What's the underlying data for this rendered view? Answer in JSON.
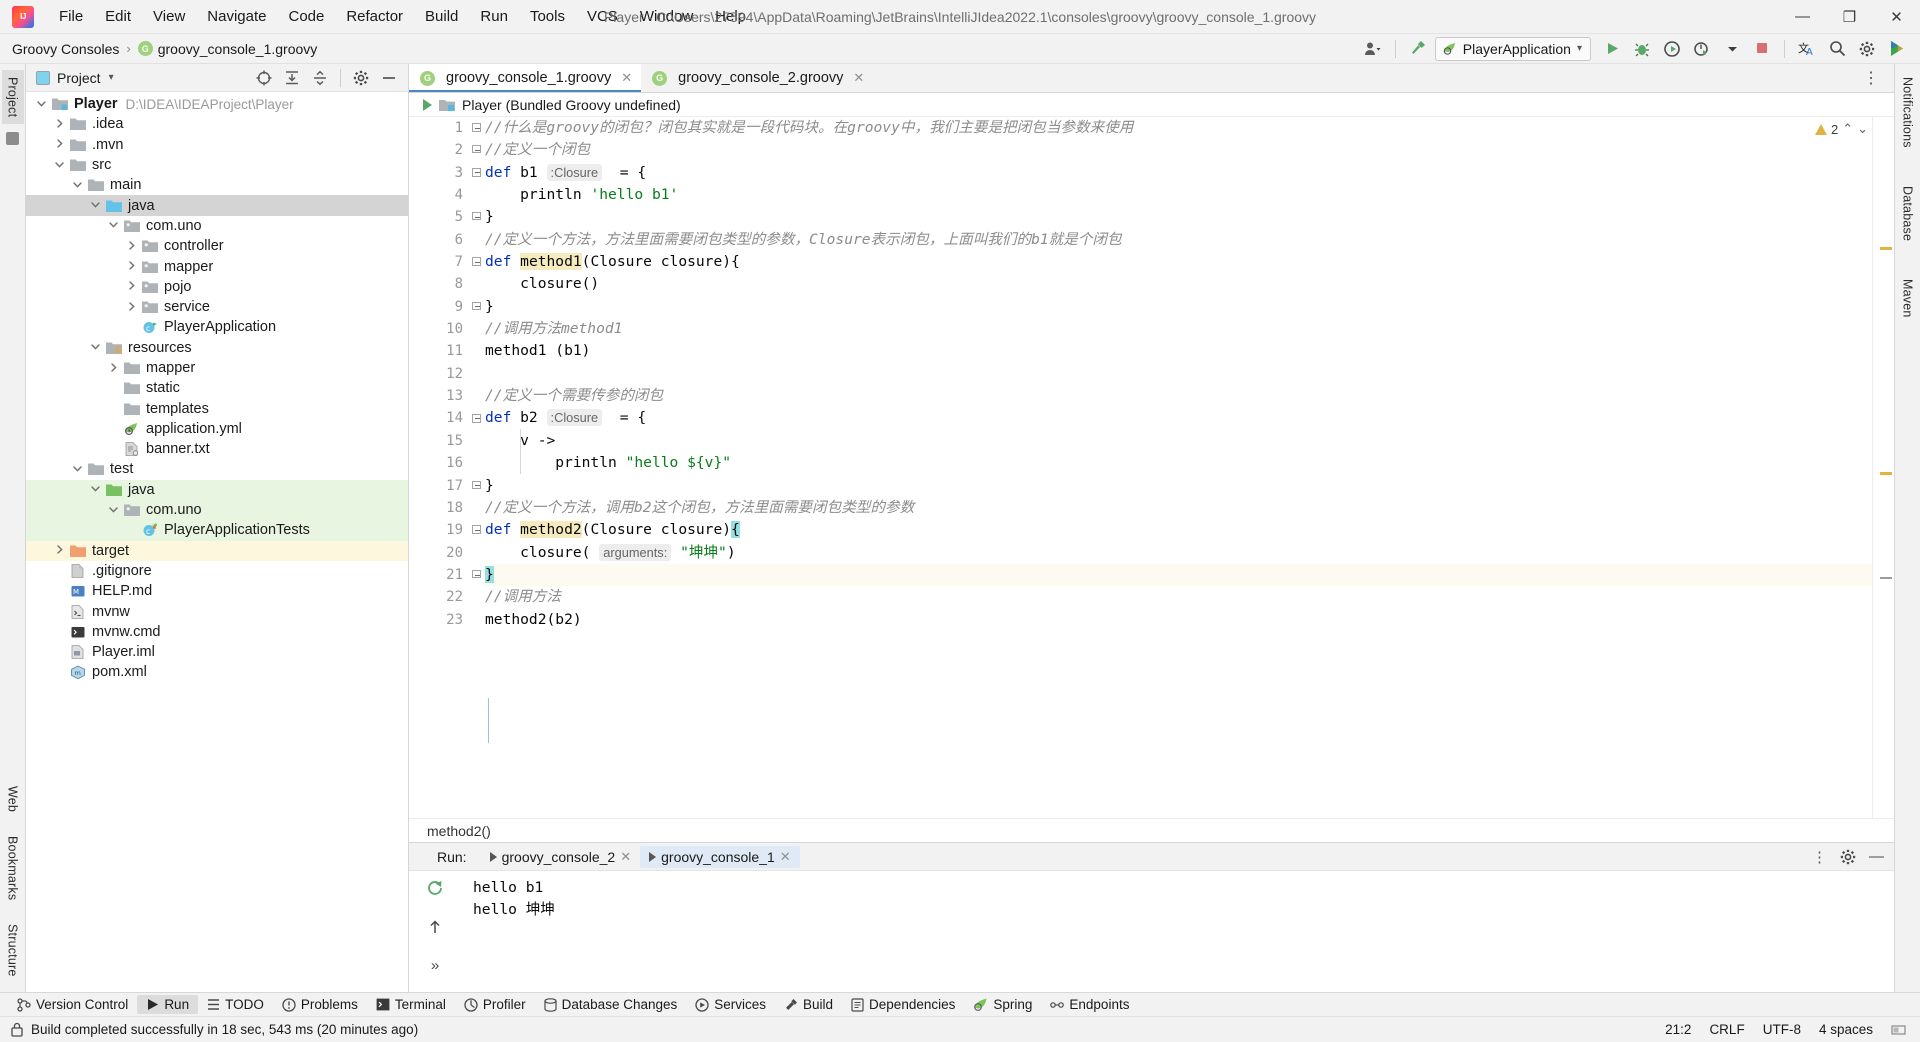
{
  "window": {
    "title": "Player - C:\\Users\\27594\\AppData\\Roaming\\JetBrains\\IntelliJIdea2022.1\\consoles\\groovy\\groovy_console_1.groovy",
    "minimize": "—",
    "maximize": "❐",
    "close": "✕"
  },
  "menubar": [
    {
      "label": "File"
    },
    {
      "label": "Edit"
    },
    {
      "label": "View"
    },
    {
      "label": "Navigate"
    },
    {
      "label": "Code"
    },
    {
      "label": "Refactor"
    },
    {
      "label": "Build"
    },
    {
      "label": "Run"
    },
    {
      "label": "Tools"
    },
    {
      "label": "VCS"
    },
    {
      "label": "Window"
    },
    {
      "label": "Help"
    }
  ],
  "navbar": {
    "crumbs": [
      "Groovy Consoles",
      "groovy_console_1.groovy"
    ],
    "separator": "›",
    "groovy_badge": "G",
    "run_config": "PlayerApplication",
    "run_config_chevron": "▾"
  },
  "left_strip": {
    "tabs": [
      "Project",
      "Structure",
      "Bookmarks",
      "Web"
    ]
  },
  "right_strip": {
    "tabs": [
      "Notifications",
      "Database",
      "Maven"
    ]
  },
  "project_panel": {
    "title": "Project",
    "chevron": "▾",
    "tree": [
      {
        "label": "Player",
        "path": "D:\\IDEA\\IDEAProject\\Player",
        "indent": 0,
        "chev": "down",
        "icon": "module-folder",
        "bold": true,
        "state": ""
      },
      {
        "label": ".idea",
        "path": "",
        "indent": 1,
        "chev": "right",
        "icon": "folder",
        "bold": false,
        "state": ""
      },
      {
        "label": ".mvn",
        "path": "",
        "indent": 1,
        "chev": "right",
        "icon": "folder",
        "bold": false,
        "state": ""
      },
      {
        "label": "src",
        "path": "",
        "indent": 1,
        "chev": "down",
        "icon": "folder",
        "bold": false,
        "state": ""
      },
      {
        "label": "main",
        "path": "",
        "indent": 2,
        "chev": "down",
        "icon": "folder",
        "bold": false,
        "state": ""
      },
      {
        "label": "java",
        "path": "",
        "indent": 3,
        "chev": "down",
        "icon": "source-folder",
        "bold": false,
        "state": "sel-gray"
      },
      {
        "label": "com.uno",
        "path": "",
        "indent": 4,
        "chev": "down",
        "icon": "package",
        "bold": false,
        "state": ""
      },
      {
        "label": "controller",
        "path": "",
        "indent": 5,
        "chev": "right",
        "icon": "package",
        "bold": false,
        "state": ""
      },
      {
        "label": "mapper",
        "path": "",
        "indent": 5,
        "chev": "right",
        "icon": "package",
        "bold": false,
        "state": ""
      },
      {
        "label": "pojo",
        "path": "",
        "indent": 5,
        "chev": "right",
        "icon": "package",
        "bold": false,
        "state": ""
      },
      {
        "label": "service",
        "path": "",
        "indent": 5,
        "chev": "right",
        "icon": "package",
        "bold": false,
        "state": ""
      },
      {
        "label": "PlayerApplication",
        "path": "",
        "indent": 5,
        "chev": "none",
        "icon": "spring-class",
        "bold": false,
        "state": ""
      },
      {
        "label": "resources",
        "path": "",
        "indent": 3,
        "chev": "down",
        "icon": "resource-folder",
        "bold": false,
        "state": ""
      },
      {
        "label": "mapper",
        "path": "",
        "indent": 4,
        "chev": "right",
        "icon": "folder",
        "bold": false,
        "state": ""
      },
      {
        "label": "static",
        "path": "",
        "indent": 4,
        "chev": "none",
        "icon": "folder",
        "bold": false,
        "state": ""
      },
      {
        "label": "templates",
        "path": "",
        "indent": 4,
        "chev": "none",
        "icon": "folder",
        "bold": false,
        "state": ""
      },
      {
        "label": "application.yml",
        "path": "",
        "indent": 4,
        "chev": "none",
        "icon": "spring-yml",
        "bold": false,
        "state": ""
      },
      {
        "label": "banner.txt",
        "path": "",
        "indent": 4,
        "chev": "none",
        "icon": "text-file",
        "bold": false,
        "state": ""
      },
      {
        "label": "test",
        "path": "",
        "indent": 2,
        "chev": "down",
        "icon": "folder",
        "bold": false,
        "state": ""
      },
      {
        "label": "java",
        "path": "",
        "indent": 3,
        "chev": "down",
        "icon": "test-source-folder",
        "bold": false,
        "state": "src-test"
      },
      {
        "label": "com.uno",
        "path": "",
        "indent": 4,
        "chev": "down",
        "icon": "package",
        "bold": false,
        "state": "src-test"
      },
      {
        "label": "PlayerApplicationTests",
        "path": "",
        "indent": 5,
        "chev": "none",
        "icon": "test-class",
        "bold": false,
        "state": "src-test"
      },
      {
        "label": "target",
        "path": "",
        "indent": 1,
        "chev": "right",
        "icon": "excluded-folder",
        "bold": false,
        "state": "excluded"
      },
      {
        "label": ".gitignore",
        "path": "",
        "indent": 1,
        "chev": "none",
        "icon": "gitignore-file",
        "bold": false,
        "state": ""
      },
      {
        "label": "HELP.md",
        "path": "",
        "indent": 1,
        "chev": "none",
        "icon": "md-file",
        "bold": false,
        "state": ""
      },
      {
        "label": "mvnw",
        "path": "",
        "indent": 1,
        "chev": "none",
        "icon": "script-file",
        "bold": false,
        "state": ""
      },
      {
        "label": "mvnw.cmd",
        "path": "",
        "indent": 1,
        "chev": "none",
        "icon": "cmd-file",
        "bold": false,
        "state": ""
      },
      {
        "label": "Player.iml",
        "path": "",
        "indent": 1,
        "chev": "none",
        "icon": "iml-file",
        "bold": false,
        "state": ""
      },
      {
        "label": "pom.xml",
        "path": "",
        "indent": 1,
        "chev": "none",
        "icon": "maven-file",
        "bold": false,
        "state": ""
      }
    ]
  },
  "editor": {
    "tabs": [
      {
        "label": "groovy_console_1.groovy",
        "badge": "G",
        "active": true,
        "close": "✕"
      },
      {
        "label": "groovy_console_2.groovy",
        "badge": "G",
        "active": false,
        "close": "✕"
      }
    ],
    "run_header": "Player (Bundled Groovy undefined)",
    "inspection": {
      "warnings": "2",
      "warn_icon": "warning-triangle",
      "chevron_up": "⌃",
      "chevron_down": "⌄"
    },
    "breadcrumb": "method2()",
    "lines": [
      {
        "n": "1",
        "fold": "start",
        "text": "//什么是groovy的闭包？闭包其实就是一段代码块。在groovy中，我们主要是把闭包当参数来使用"
      },
      {
        "n": "2",
        "fold": "end",
        "text": "//定义一个闭包"
      },
      {
        "n": "3",
        "fold": "start",
        "text": "def b1 :Closure  = {"
      },
      {
        "n": "4",
        "fold": "",
        "text": "    println 'hello b1'"
      },
      {
        "n": "5",
        "fold": "end",
        "text": "}"
      },
      {
        "n": "6",
        "fold": "",
        "text": "//定义一个方法，方法里面需要闭包类型的参数，Closure表示闭包，上面叫我们的b1就是个闭包"
      },
      {
        "n": "7",
        "fold": "start",
        "text": "def method1(Closure closure){"
      },
      {
        "n": "8",
        "fold": "",
        "text": "    closure()"
      },
      {
        "n": "9",
        "fold": "end",
        "text": "}"
      },
      {
        "n": "10",
        "fold": "",
        "text": "//调用方法method1"
      },
      {
        "n": "11",
        "fold": "",
        "text": "method1 (b1)"
      },
      {
        "n": "12",
        "fold": "",
        "text": ""
      },
      {
        "n": "13",
        "fold": "",
        "text": "//定义一个需要传参的闭包"
      },
      {
        "n": "14",
        "fold": "start",
        "text": "def b2 :Closure  = {"
      },
      {
        "n": "15",
        "fold": "",
        "text": "    v ->"
      },
      {
        "n": "16",
        "fold": "",
        "text": "        println \"hello ${v}\""
      },
      {
        "n": "17",
        "fold": "end",
        "text": "}"
      },
      {
        "n": "18",
        "fold": "",
        "text": "//定义一个方法，调用b2这个闭包，方法里面需要闭包类型的参数"
      },
      {
        "n": "19",
        "fold": "start",
        "text": "def method2(Closure closure){"
      },
      {
        "n": "20",
        "fold": "",
        "text": "    closure( arguments: \"坤坤\")"
      },
      {
        "n": "21",
        "fold": "end",
        "text": "}"
      },
      {
        "n": "22",
        "fold": "",
        "text": "//调用方法"
      },
      {
        "n": "23",
        "fold": "",
        "text": "method2(b2)"
      }
    ],
    "inlay_closure": ":Closure",
    "inlay_arguments": "arguments:",
    "tokens": {
      "def": "def",
      "b1": "b1",
      "b2": "b2",
      "method1": "method1",
      "method2": "method2",
      "println": "println",
      "closure": "closure",
      "Closure": "Closure"
    }
  },
  "run_window": {
    "label": "Run:",
    "tabs": [
      {
        "label": "groovy_console_2",
        "active": false,
        "close": "✕"
      },
      {
        "label": "groovy_console_1",
        "active": true,
        "close": "✕"
      }
    ],
    "console_lines": [
      "hello b1",
      "hello 坤坤"
    ],
    "gear_icon": "gear-icon",
    "minimize_icon": "—",
    "more_icon": "⋮"
  },
  "bottom_toolbar": [
    {
      "label": "Version Control",
      "icon": "vcs-icon",
      "active": false
    },
    {
      "label": "Run",
      "icon": "run-icon",
      "active": true
    },
    {
      "label": "TODO",
      "icon": "todo-icon",
      "active": false
    },
    {
      "label": "Problems",
      "icon": "problems-icon",
      "active": false
    },
    {
      "label": "Terminal",
      "icon": "terminal-icon",
      "active": false
    },
    {
      "label": "Profiler",
      "icon": "profiler-icon",
      "active": false
    },
    {
      "label": "Database Changes",
      "icon": "database-icon",
      "active": false
    },
    {
      "label": "Services",
      "icon": "services-icon",
      "active": false
    },
    {
      "label": "Build",
      "icon": "build-icon",
      "active": false
    },
    {
      "label": "Dependencies",
      "icon": "dependencies-icon",
      "active": false
    },
    {
      "label": "Spring",
      "icon": "spring-icon",
      "active": false
    },
    {
      "label": "Endpoints",
      "icon": "endpoints-icon",
      "active": false
    }
  ],
  "statusbar": {
    "message": "Build completed successfully in 18 sec, 543 ms (20 minutes ago)",
    "caret": "21:2",
    "line_sep": "CRLF",
    "encoding": "UTF-8",
    "indent": "4 spaces",
    "lock_icon": "lock-icon"
  },
  "colors": {
    "accent_blue": "#4a86c8",
    "green": "#59a869",
    "keyword": "#0033b3",
    "string": "#067d17",
    "comment": "#8c8c8c",
    "test_source_bg": "#e8f5e1",
    "excluded_bg": "#fdf8dd",
    "identifier_highlight": "#f6ebbe",
    "brace_highlight": "#93e0e3"
  }
}
